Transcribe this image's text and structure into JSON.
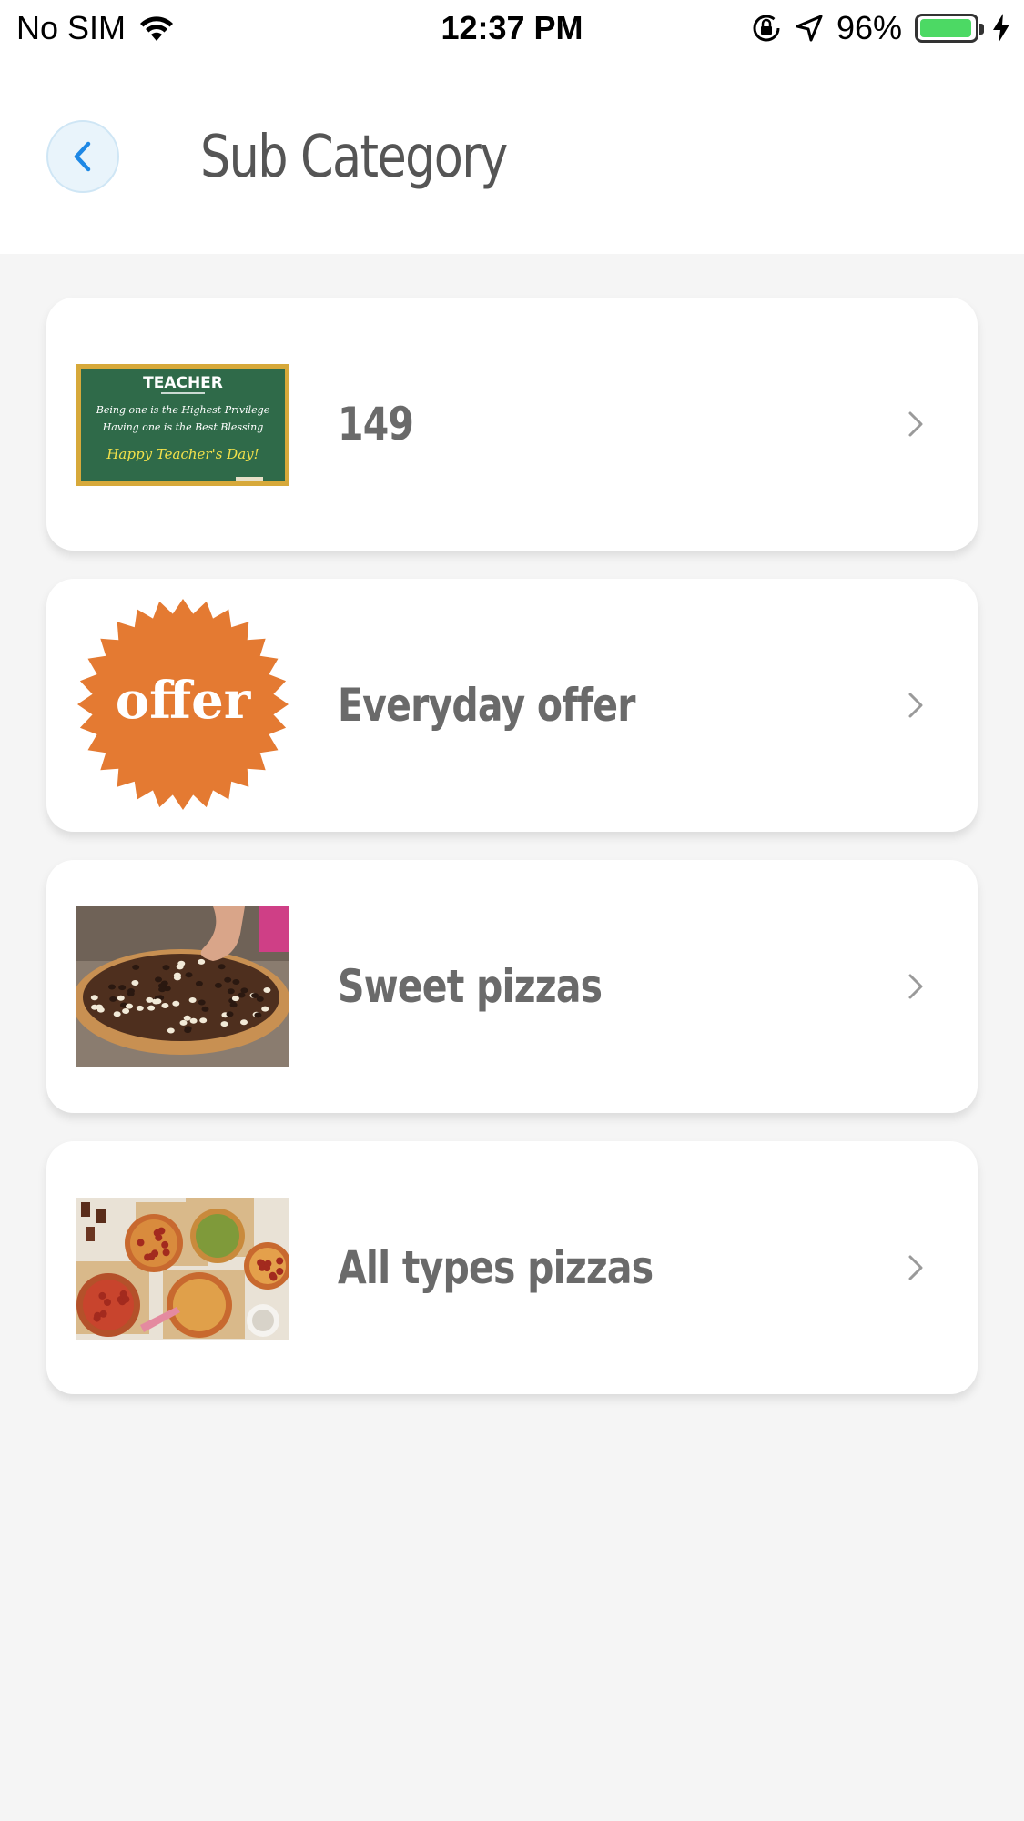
{
  "status_bar": {
    "carrier": "No SIM",
    "time": "12:37 PM",
    "battery": "96%",
    "battery_level": 0.96
  },
  "header": {
    "title": "Sub Category",
    "back_icon": "chevron-left-icon"
  },
  "categories": [
    {
      "label": "149",
      "image": {
        "kind": "chalkboard",
        "heading": "TEACHER",
        "line1": "Being one is the Highest Privilege",
        "line2": "Having one is the Best Blessing",
        "line3": "Happy Teacher's Day!"
      }
    },
    {
      "label": "Everyday offer",
      "image": {
        "kind": "badge",
        "text": "offer",
        "color": "#e47a32"
      }
    },
    {
      "label": "Sweet pizzas",
      "image": {
        "kind": "photo-sweet-pizza"
      }
    },
    {
      "label": "All types pizzas",
      "image": {
        "kind": "photo-pizzas"
      }
    }
  ],
  "colors": {
    "accent": "#1e88e5",
    "background": "#f5f5f5",
    "card": "#ffffff",
    "label": "#6a6a6a",
    "title": "#555555"
  }
}
